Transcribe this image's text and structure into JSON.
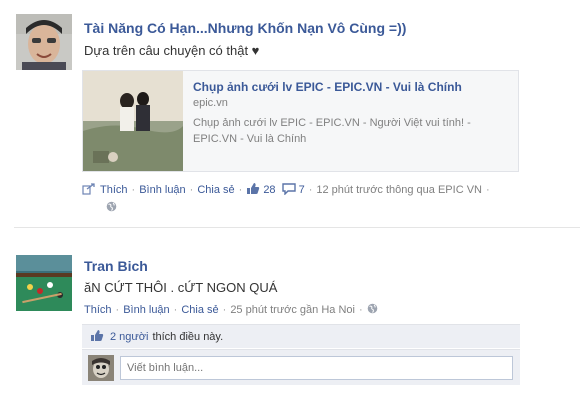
{
  "post1": {
    "author": "Tài Năng Có Hạn...Nhưng Khốn Nạn Vô Cùng =))",
    "message": "Dựa trên câu chuyện có thật ♥",
    "share": {
      "title": "Chụp ảnh cưới lv EPIC - EPIC.VN - Vui là Chính",
      "domain": "epic.vn",
      "description": "Chụp ảnh cưới lv EPIC - EPIC.VN - Người Việt vui tính! - EPIC.VN - Vui là Chính"
    },
    "actions": {
      "like": "Thích",
      "comment": "Bình luận",
      "share": "Chia sẻ",
      "like_count": "28",
      "comment_count": "7",
      "timestamp": "12 phút trước thông qua EPIC VN"
    }
  },
  "post2": {
    "author": "Tran Bich",
    "message": "ăN CỨT THÔI . cỨT NGON QUÁ",
    "actions": {
      "like": "Thích",
      "comment": "Bình luận",
      "share": "Chia sẻ",
      "timestamp": "25 phút trước gần Ha Noi"
    },
    "likes": {
      "count_link": "2 người",
      "text": "thích điều này."
    },
    "comment_box": {
      "placeholder": "Viết bình luận..."
    }
  },
  "colors": {
    "link": "#3b5998",
    "meta": "#808080",
    "panel": "#edeff4"
  }
}
